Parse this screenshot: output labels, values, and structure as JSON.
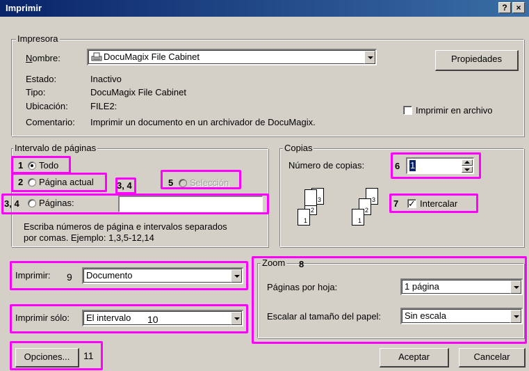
{
  "window": {
    "title": "Imprimir",
    "help_label": "?",
    "close_label": "×"
  },
  "printer": {
    "group_label": "Impresora",
    "name_label": "Nombre:",
    "name_value": "DocuMagix File Cabinet",
    "properties_button": "Propiedades",
    "status_label": "Estado:",
    "status_value": "Inactivo",
    "type_label": "Tipo:",
    "type_value": "DocuMagix File Cabinet",
    "location_label": "Ubicación:",
    "location_value": "FILE2:",
    "comment_label": "Comentario:",
    "comment_value": "Imprimir un documento en un archivador de DocuMagix.",
    "print_to_file_label": "Imprimir en archivo",
    "print_to_file_checked": false
  },
  "range": {
    "group_label": "Intervalo de páginas",
    "all_label": "Todo",
    "current_label": "Página actual",
    "selection_label": "Selección",
    "pages_label": "Páginas:",
    "pages_value": "",
    "hint_line1": "Escriba números de página e intervalos separados",
    "hint_line2": "por comas. Ejemplo: 1,3,5-12,14"
  },
  "copies": {
    "group_label": "Copias",
    "count_label": "Número de copias:",
    "count_value": "1",
    "collate_label": "Intercalar",
    "collate_checked": true,
    "page_numbers": [
      "1",
      "2",
      "3"
    ]
  },
  "print_what": {
    "label": "Imprimir:",
    "value": "Documento"
  },
  "print_only": {
    "label": "Imprimir sólo:",
    "value": "El intervalo"
  },
  "zoom": {
    "group_label": "Zoom",
    "pages_per_sheet_label": "Páginas por hoja:",
    "pages_per_sheet_value": "1 página",
    "scale_label": "Escalar al tamaño del papel:",
    "scale_value": "Sin escala"
  },
  "buttons": {
    "options": "Opciones...",
    "ok": "Aceptar",
    "cancel": "Cancelar"
  },
  "annotations": {
    "n1": "1",
    "n2": "2",
    "n34a": "3, 4",
    "n34b": "3, 4",
    "n5": "5",
    "n6": "6",
    "n7": "7",
    "n8": "8",
    "n9": "9",
    "n10": "10",
    "n11": "11",
    "highlight_color": "#ff00ff"
  }
}
